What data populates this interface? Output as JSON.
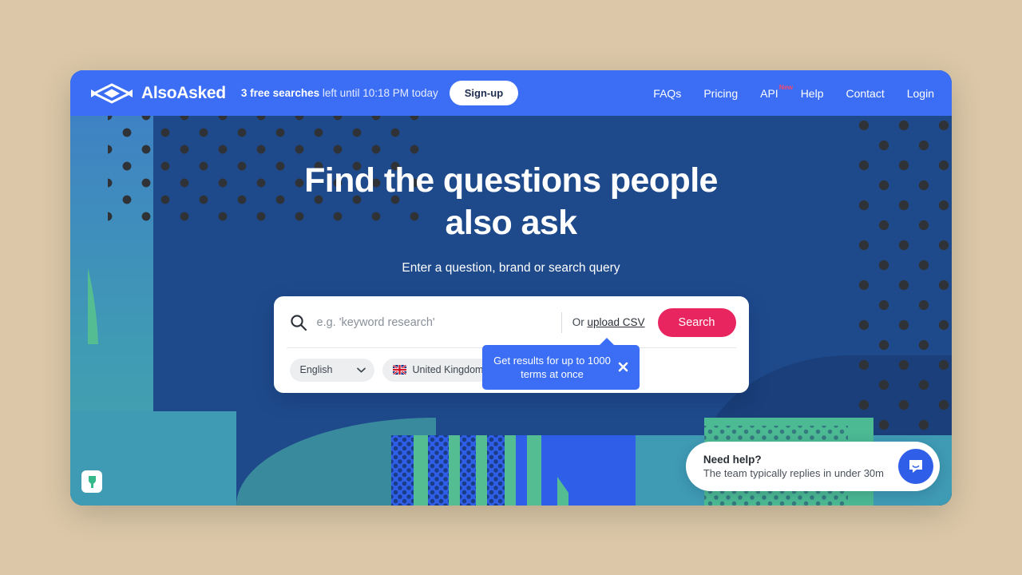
{
  "brand": {
    "name": "AlsoAsked",
    "logo_icon": "eye-diamond-logo-icon"
  },
  "topbar": {
    "free_searches_count": "3 free searches",
    "free_searches_rest": " left until 10:18 PM today",
    "signup_label": "Sign-up",
    "nav_links": [
      {
        "label": "FAQs",
        "badge": ""
      },
      {
        "label": "Pricing",
        "badge": ""
      },
      {
        "label": "API",
        "badge": "New"
      },
      {
        "label": "Help",
        "badge": ""
      },
      {
        "label": "Contact",
        "badge": ""
      },
      {
        "label": "Login",
        "badge": ""
      }
    ]
  },
  "hero": {
    "heading": "Find the questions people also ask",
    "subtitle": "Enter a question, brand or search query"
  },
  "search": {
    "placeholder": "e.g. 'keyword research'",
    "value": "",
    "search_icon": "magnifier-icon",
    "or_label": "Or ",
    "upload_csv_label": "upload CSV",
    "search_button_label": "Search",
    "filters": [
      {
        "label": "English",
        "icon": ""
      },
      {
        "label": "United Kingdom",
        "icon": "uk-flag-icon"
      }
    ]
  },
  "tooltip": {
    "text": "Get results for up to 1000 terms at once",
    "close_icon": "close-x-icon"
  },
  "chat": {
    "title": "Need help?",
    "subtitle": "The team typically replies in under 30m",
    "button_icon": "speech-bubble-icon"
  },
  "corner_badge": {
    "icon": "keyhole-icon"
  },
  "colors": {
    "page_background": "#dcc8a8",
    "topbar_blue": "#3b6ef5",
    "hero_navy": "#1e4a8c",
    "accent_pink": "#e8255f",
    "badge_red": "#f4476b",
    "teal": "#3f9bb4",
    "green": "#4cba93"
  }
}
